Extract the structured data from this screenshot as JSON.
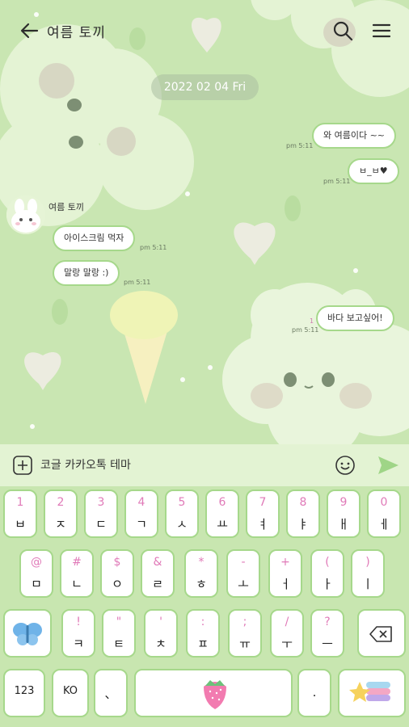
{
  "header": {
    "title": "여름 토끼"
  },
  "date_pill": "2022 02 04 Fri",
  "messages": {
    "sent": [
      {
        "text": "와 여름이다 ~~",
        "time": "pm 5:11"
      },
      {
        "text": "ㅂ_ㅂ♥",
        "time": "pm 5:11"
      },
      {
        "text": "바다 보고싶어!",
        "time": "pm 5:11",
        "unread": "1"
      }
    ],
    "sender_name": "여름 토끼",
    "received": [
      {
        "text": "아이스크림 먹자",
        "time": "pm 5:11"
      },
      {
        "text": "말랑 말랑 :)",
        "time": "pm 5:11"
      }
    ]
  },
  "input": {
    "value": "코글 카카오톡 테마"
  },
  "keyboard": {
    "row1": [
      {
        "sub": "1",
        "main": "ㅂ"
      },
      {
        "sub": "2",
        "main": "ㅈ"
      },
      {
        "sub": "3",
        "main": "ㄷ"
      },
      {
        "sub": "4",
        "main": "ㄱ"
      },
      {
        "sub": "5",
        "main": "ㅅ"
      },
      {
        "sub": "6",
        "main": "ㅛ"
      },
      {
        "sub": "7",
        "main": "ㅕ"
      },
      {
        "sub": "8",
        "main": "ㅑ"
      },
      {
        "sub": "9",
        "main": "ㅐ"
      },
      {
        "sub": "0",
        "main": "ㅔ"
      }
    ],
    "row2": [
      {
        "sub": "@",
        "main": "ㅁ"
      },
      {
        "sub": "#",
        "main": "ㄴ"
      },
      {
        "sub": "$",
        "main": "ㅇ"
      },
      {
        "sub": "&",
        "main": "ㄹ"
      },
      {
        "sub": "*",
        "main": "ㅎ"
      },
      {
        "sub": "-",
        "main": "ㅗ"
      },
      {
        "sub": "+",
        "main": "ㅓ"
      },
      {
        "sub": "(",
        "main": "ㅏ"
      },
      {
        "sub": ")",
        "main": "ㅣ"
      }
    ],
    "row3": [
      {
        "sub": "!",
        "main": "ㅋ"
      },
      {
        "sub": "\"",
        "main": "ㅌ"
      },
      {
        "sub": "'",
        "main": "ㅊ"
      },
      {
        "sub": ":",
        "main": "ㅍ"
      },
      {
        "sub": ";",
        "main": "ㅠ"
      },
      {
        "sub": "/",
        "main": "ㅜ"
      },
      {
        "sub": "?",
        "main": "ㅡ"
      }
    ],
    "row4": {
      "num": "123",
      "lang": "KO",
      "comma": "、",
      "period": "."
    }
  }
}
